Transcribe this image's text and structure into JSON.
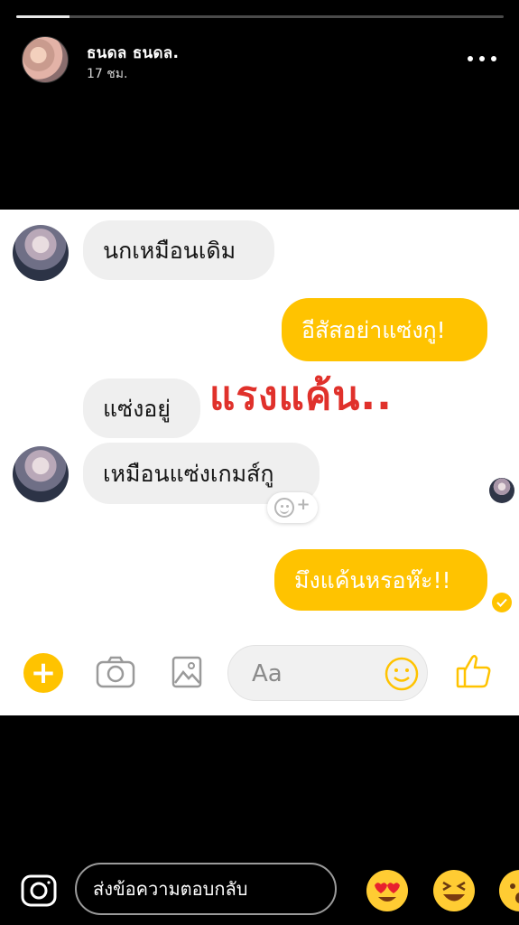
{
  "story": {
    "progress": 0.11,
    "author_name": "ธนดล ธนดล.",
    "posted_time": "17 ชม.",
    "more_icon": "more-horizontal-icon"
  },
  "chat": {
    "messages": [
      {
        "direction": "incoming",
        "text": "นกเหมือนเดิม"
      },
      {
        "direction": "outgoing",
        "text": "อีสัสอย่าแซ่งกู!"
      },
      {
        "direction": "incoming",
        "text": "แซ่งอยู่"
      },
      {
        "direction": "incoming",
        "text": "เหมือนแซ่งเกมส์กู"
      },
      {
        "direction": "outgoing",
        "text": "มึงแค้นหรอห๊ะ!!"
      }
    ],
    "overlay_caption": "แรงแค้น..",
    "composer": {
      "placeholder": "Aa",
      "icons": [
        "plus-icon",
        "camera-icon",
        "gallery-icon",
        "emoji-icon",
        "thumbs-up-icon"
      ]
    },
    "colors": {
      "outgoing_bubble": "#ffc300",
      "incoming_bubble": "#efefef",
      "caption": "#e0312b"
    }
  },
  "reply": {
    "placeholder": "ส่งข้อความตอบกลับ",
    "camera_icon": "camera-icon",
    "quick_reactions": [
      "heart-eyes-emoji-icon",
      "laughing-emoji-icon",
      "surprised-emoji-icon"
    ]
  }
}
